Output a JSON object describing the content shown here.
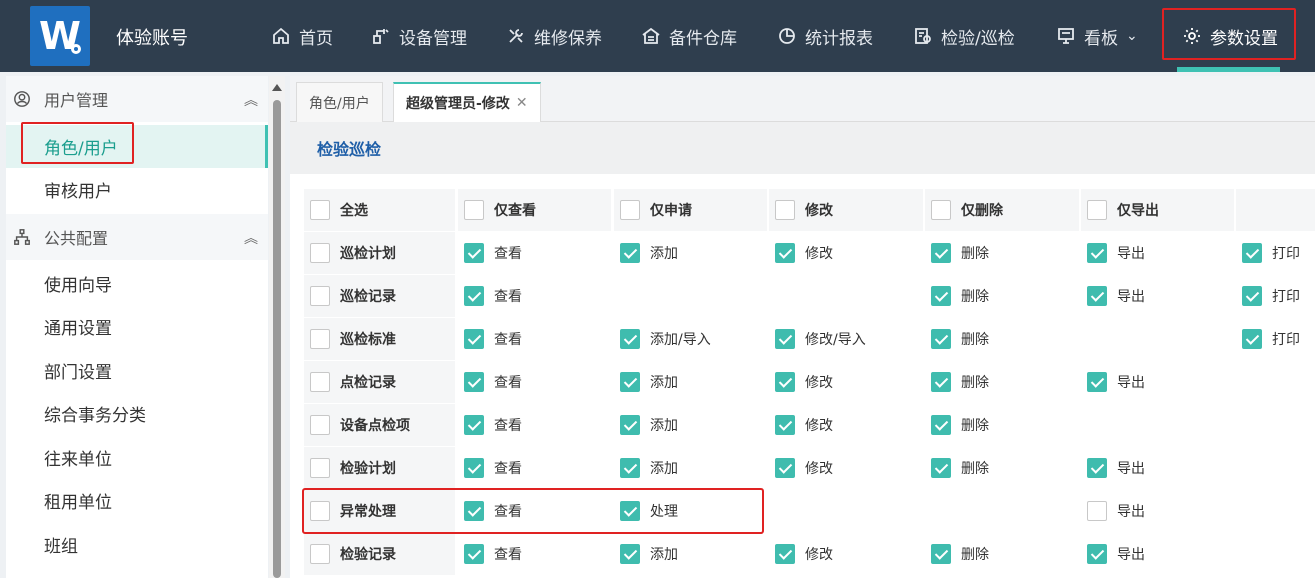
{
  "header": {
    "logo_letter": "W",
    "app_title": "体验账号",
    "nav": [
      {
        "label": "首页",
        "icon": "home-icon"
      },
      {
        "label": "设备管理",
        "icon": "device-icon"
      },
      {
        "label": "维修保养",
        "icon": "tools-icon"
      },
      {
        "label": "备件仓库",
        "icon": "warehouse-icon"
      },
      {
        "label": "统计报表",
        "icon": "pie-chart-icon"
      },
      {
        "label": "检验/巡检",
        "icon": "inspection-icon"
      },
      {
        "label": "看板",
        "icon": "board-icon",
        "dropdown": "⌄"
      },
      {
        "label": "参数设置",
        "icon": "gear-icon",
        "active": true
      }
    ]
  },
  "sidebar": {
    "groups": [
      {
        "label": "用户管理",
        "icon": "user-circle-icon",
        "chevron": "︽"
      },
      {
        "label": "公共配置",
        "icon": "org-chart-icon",
        "chevron": "︽"
      }
    ],
    "items": [
      "角色/用户",
      "审核用户",
      "使用向导",
      "通用设置",
      "部门设置",
      "综合事务分类",
      "往来单位",
      "租用单位",
      "班组"
    ],
    "active_item": "角色/用户"
  },
  "tabs": [
    {
      "label": "角色/用户"
    },
    {
      "label": "超级管理员-修改",
      "close": "✕",
      "active": true
    }
  ],
  "section_title": "检验巡检",
  "permission_table": {
    "header": [
      "全选",
      "仅查看",
      "仅申请",
      "修改",
      "仅删除",
      "仅导出"
    ],
    "rows": [
      {
        "name": "巡检计划",
        "cells": [
          {
            "label": "查看",
            "checked": true
          },
          {
            "label": "添加",
            "checked": true
          },
          {
            "label": "修改",
            "checked": true
          },
          {
            "label": "删除",
            "checked": true
          },
          {
            "label": "导出",
            "checked": true
          },
          {
            "label": "打印",
            "checked": true
          }
        ]
      },
      {
        "name": "巡检记录",
        "cells": [
          {
            "label": "查看",
            "checked": true
          },
          null,
          null,
          {
            "label": "删除",
            "checked": true
          },
          {
            "label": "导出",
            "checked": true
          },
          {
            "label": "打印",
            "checked": true
          }
        ]
      },
      {
        "name": "巡检标准",
        "cells": [
          {
            "label": "查看",
            "checked": true
          },
          {
            "label": "添加/导入",
            "checked": true
          },
          {
            "label": "修改/导入",
            "checked": true
          },
          {
            "label": "删除",
            "checked": true
          },
          null,
          {
            "label": "打印",
            "checked": true
          }
        ]
      },
      {
        "name": "点检记录",
        "cells": [
          {
            "label": "查看",
            "checked": true
          },
          {
            "label": "添加",
            "checked": true
          },
          {
            "label": "修改",
            "checked": true
          },
          {
            "label": "删除",
            "checked": true
          },
          {
            "label": "导出",
            "checked": true
          },
          null
        ]
      },
      {
        "name": "设备点检项",
        "cells": [
          {
            "label": "查看",
            "checked": true
          },
          {
            "label": "添加",
            "checked": true
          },
          {
            "label": "修改",
            "checked": true
          },
          {
            "label": "删除",
            "checked": true
          },
          null,
          null
        ]
      },
      {
        "name": "检验计划",
        "cells": [
          {
            "label": "查看",
            "checked": true
          },
          {
            "label": "添加",
            "checked": true
          },
          {
            "label": "修改",
            "checked": true
          },
          {
            "label": "删除",
            "checked": true
          },
          {
            "label": "导出",
            "checked": true
          },
          null
        ]
      },
      {
        "name": "异常处理",
        "cells": [
          {
            "label": "查看",
            "checked": true
          },
          {
            "label": "处理",
            "checked": true
          },
          null,
          null,
          {
            "label": "导出",
            "checked": false
          },
          null
        ]
      },
      {
        "name": "检验记录",
        "cells": [
          {
            "label": "查看",
            "checked": true
          },
          {
            "label": "添加",
            "checked": true
          },
          {
            "label": "修改",
            "checked": true
          },
          {
            "label": "删除",
            "checked": true
          },
          {
            "label": "导出",
            "checked": true
          },
          null
        ]
      }
    ]
  },
  "colors": {
    "topbar": "#2f3e4e",
    "accent": "#3fbcae",
    "highlight": "#e02222",
    "section_title": "#1f5fa8"
  }
}
